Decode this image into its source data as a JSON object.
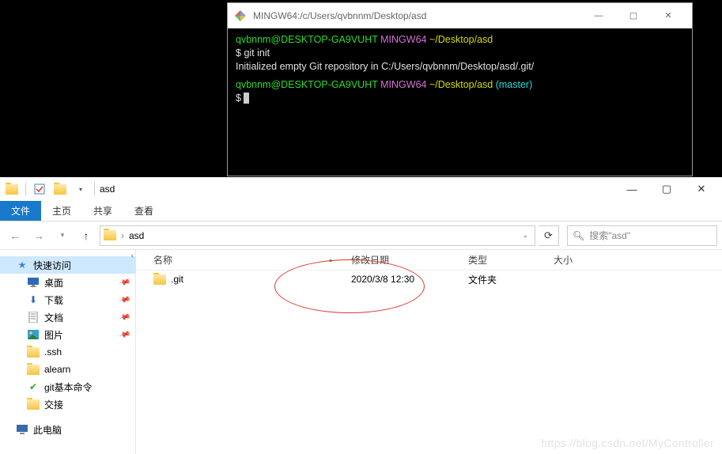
{
  "terminal": {
    "title": "MINGW64:/c/Users/qvbnnm/Desktop/asd",
    "lines": {
      "p1_user": "qvbnnm@DESKTOP-GA9VUHT",
      "p1_sys": "MINGW64",
      "p1_path": "~/Desktop/asd",
      "cmd1_prompt": "$ ",
      "cmd1": "git init",
      "out1": "Initialized empty Git repository in C:/Users/qvbnnm/Desktop/asd/.git/",
      "p2_user": "qvbnnm@DESKTOP-GA9VUHT",
      "p2_sys": "MINGW64",
      "p2_path": "~/Desktop/asd",
      "p2_branch": "(master)",
      "cmd2_prompt": "$ "
    }
  },
  "explorer": {
    "window_title": "asd",
    "tabs": {
      "file": "文件",
      "home": "主页",
      "share": "共享",
      "view": "查看"
    },
    "address": {
      "folder": "asd",
      "sep": "›"
    },
    "search": {
      "placeholder": "搜索\"asd\""
    },
    "sidebar": {
      "quick_access": "快速访问",
      "items": [
        {
          "label": "桌面",
          "icon": "desktop",
          "pinned": true
        },
        {
          "label": "下载",
          "icon": "download",
          "pinned": true
        },
        {
          "label": "文档",
          "icon": "doc",
          "pinned": true
        },
        {
          "label": "图片",
          "icon": "pic",
          "pinned": true
        },
        {
          "label": ".ssh",
          "icon": "folder",
          "pinned": false
        },
        {
          "label": "alearn",
          "icon": "folder",
          "pinned": false
        },
        {
          "label": "git基本命令",
          "icon": "check",
          "pinned": false
        },
        {
          "label": "交接",
          "icon": "folder",
          "pinned": false
        }
      ],
      "this_pc": "此电脑"
    },
    "columns": {
      "name": "名称",
      "date": "修改日期",
      "type": "类型",
      "size": "大小"
    },
    "rows": [
      {
        "name": ".git",
        "date": "2020/3/8 12:30",
        "type": "文件夹",
        "size": ""
      }
    ]
  },
  "watermark": "https://blog.csdn.net/MyController",
  "colors": {
    "accent": "#1979ca",
    "annot": "#d9362a"
  }
}
